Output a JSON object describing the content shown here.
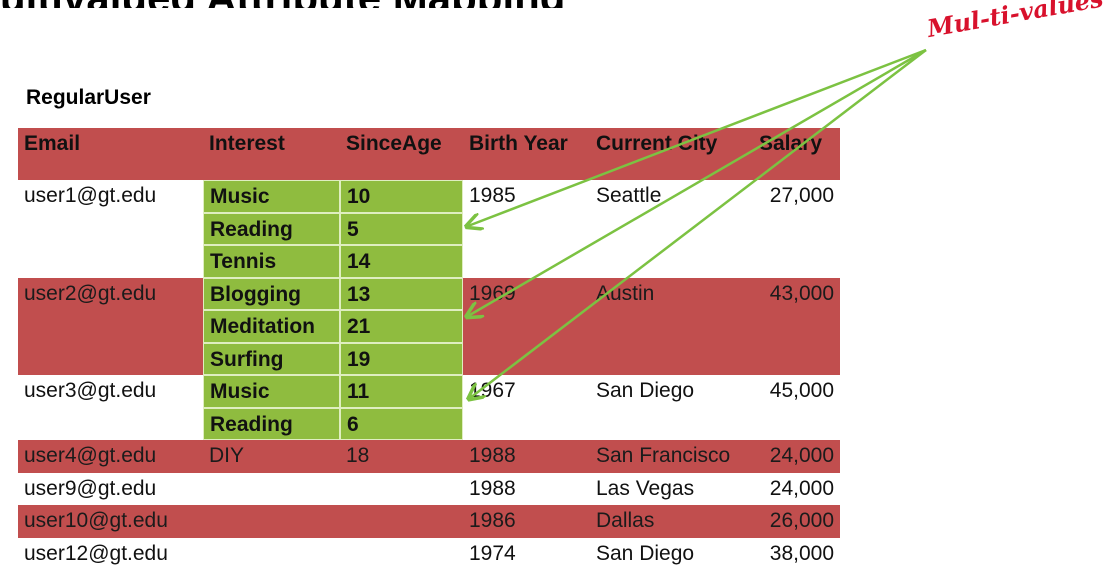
{
  "slide_title": "ultivalued Attribute Mapping",
  "table_name": "RegularUser",
  "columns": [
    "Email",
    "Interest",
    "SinceAge",
    "Birth Year",
    "Current City",
    "Salary"
  ],
  "users": [
    {
      "email": "user1@gt.edu",
      "birth_year": "1985",
      "city": "Seattle",
      "salary": "27,000",
      "shaded": false,
      "interests": [
        {
          "interest": "Music",
          "since_age": "10"
        },
        {
          "interest": "Reading",
          "since_age": "5"
        },
        {
          "interest": "Tennis",
          "since_age": "14"
        }
      ]
    },
    {
      "email": "user2@gt.edu",
      "birth_year": "1969",
      "city": "Austin",
      "salary": "43,000",
      "shaded": true,
      "interests": [
        {
          "interest": "Blogging",
          "since_age": "13"
        },
        {
          "interest": "Meditation",
          "since_age": "21"
        },
        {
          "interest": "Surfing",
          "since_age": "19"
        }
      ]
    },
    {
      "email": "user3@gt.edu",
      "birth_year": "1967",
      "city": "San Diego",
      "salary": "45,000",
      "shaded": false,
      "interests": [
        {
          "interest": "Music",
          "since_age": "11"
        },
        {
          "interest": "Reading",
          "since_age": "6"
        }
      ]
    },
    {
      "email": "user4@gt.edu",
      "birth_year": "1988",
      "city": "San Francisco",
      "salary": "24,000",
      "shaded": true,
      "interests": [
        {
          "interest": "DIY",
          "since_age": "18"
        }
      ],
      "interests_highlight": false
    },
    {
      "email": "user9@gt.edu",
      "birth_year": "1988",
      "city": "Las Vegas",
      "salary": "24,000",
      "shaded": false,
      "interests": []
    },
    {
      "email": "user10@gt.edu",
      "birth_year": "1986",
      "city": "Dallas",
      "salary": "26,000",
      "shaded": true,
      "interests": []
    },
    {
      "email": "user12@gt.edu",
      "birth_year": "1974",
      "city": "San Diego",
      "salary": "38,000",
      "shaded": false,
      "interests": []
    }
  ],
  "annotation": {
    "label": "Mul-ti-values",
    "color": "#d8112c",
    "arrow_color": "#7cc242"
  },
  "colors": {
    "header_red": "#c14e4e",
    "green_highlight": "#8fbc3f"
  }
}
